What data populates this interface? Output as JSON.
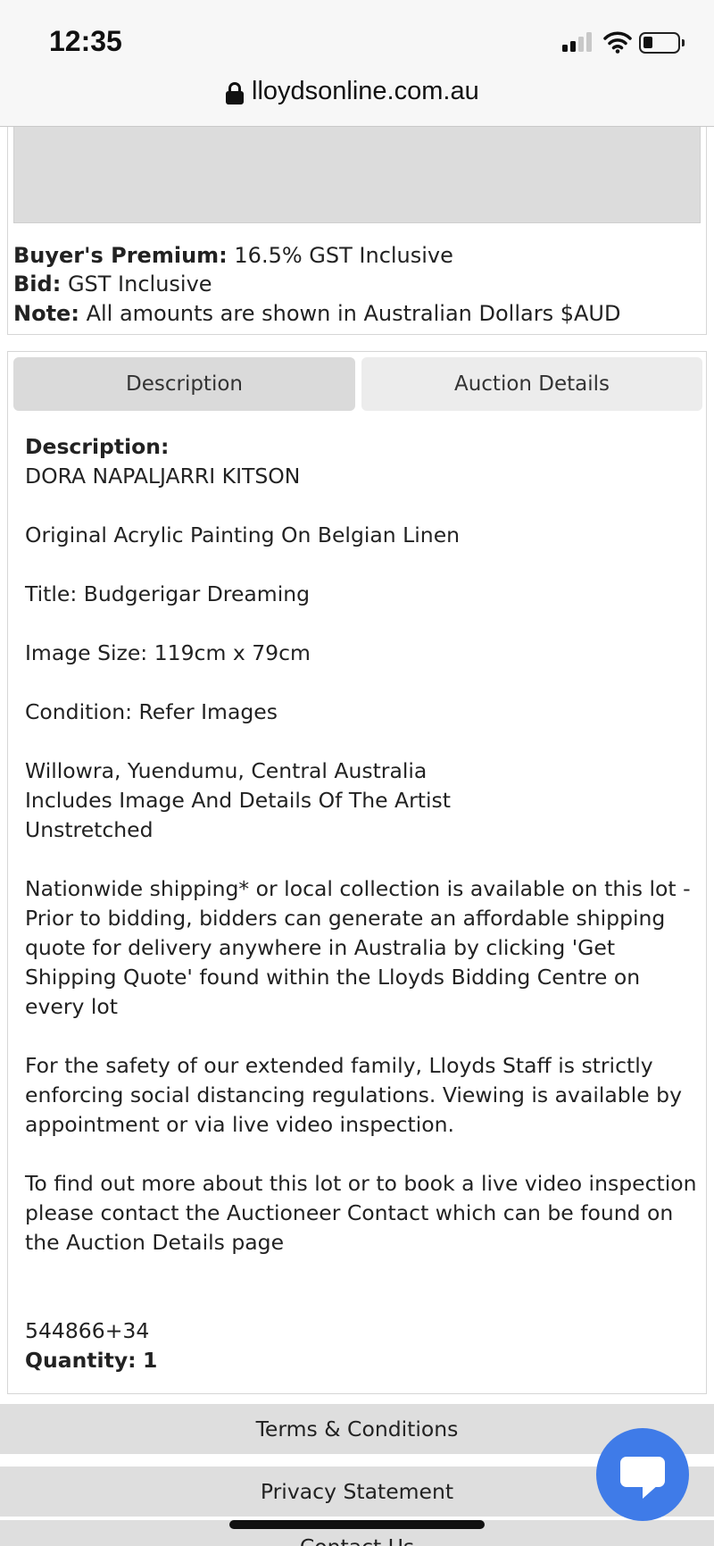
{
  "status_bar": {
    "time": "12:35"
  },
  "url_bar": {
    "domain": "lloydsonline.com.au"
  },
  "info": {
    "buyers_premium_label": "Buyer's Premium:",
    "buyers_premium_value": "16.5% GST Inclusive",
    "bid_label": "Bid:",
    "bid_value": "GST Inclusive",
    "note_label": "Note:",
    "note_value": "All amounts are shown in Australian Dollars $AUD"
  },
  "tabs": [
    {
      "label": "Description",
      "active": true
    },
    {
      "label": "Auction Details",
      "active": false
    }
  ],
  "description": {
    "heading": "Description:",
    "artist": "DORA NAPALJARRI KITSON",
    "medium": "Original Acrylic Painting On Belgian Linen",
    "title": "Title: Budgerigar Dreaming",
    "size": "Image Size: 119cm x 79cm",
    "condition": "Condition: Refer Images",
    "location": "Willowra, Yuendumu, Central Australia",
    "includes": "Includes Image And Details Of The Artist",
    "stretch": "Unstretched",
    "shipping": "Nationwide shipping* or local collection is available on this lot - Prior to bidding, bidders can generate an affordable shipping quote for delivery anywhere in Australia by clicking 'Get Shipping Quote' found within the Lloyds Bidding Centre on every lot",
    "safety": "For the safety of our extended family, Lloyds Staff is strictly enforcing social distancing regulations. Viewing is available by appointment or via live video inspection.",
    "contact": "To find out more about this lot or to book a live video inspection please contact the Auctioneer Contact which can be found on the Auction Details page",
    "lot_code": "544866+34",
    "quantity_label": "Quantity:",
    "quantity_value": "1"
  },
  "footer": {
    "terms": "Terms & Conditions",
    "privacy": "Privacy Statement",
    "contact": "Contact Us"
  },
  "icons": {
    "chat": "chat-bubble-icon",
    "lock": "lock-icon",
    "wifi": "wifi-icon",
    "signal": "cellular-signal-icon",
    "battery": "battery-icon"
  },
  "colors": {
    "chat_button": "#3f7be8",
    "tab_active": "#dadada",
    "tab_inactive": "#ececec",
    "footer_bg": "#dedede"
  }
}
